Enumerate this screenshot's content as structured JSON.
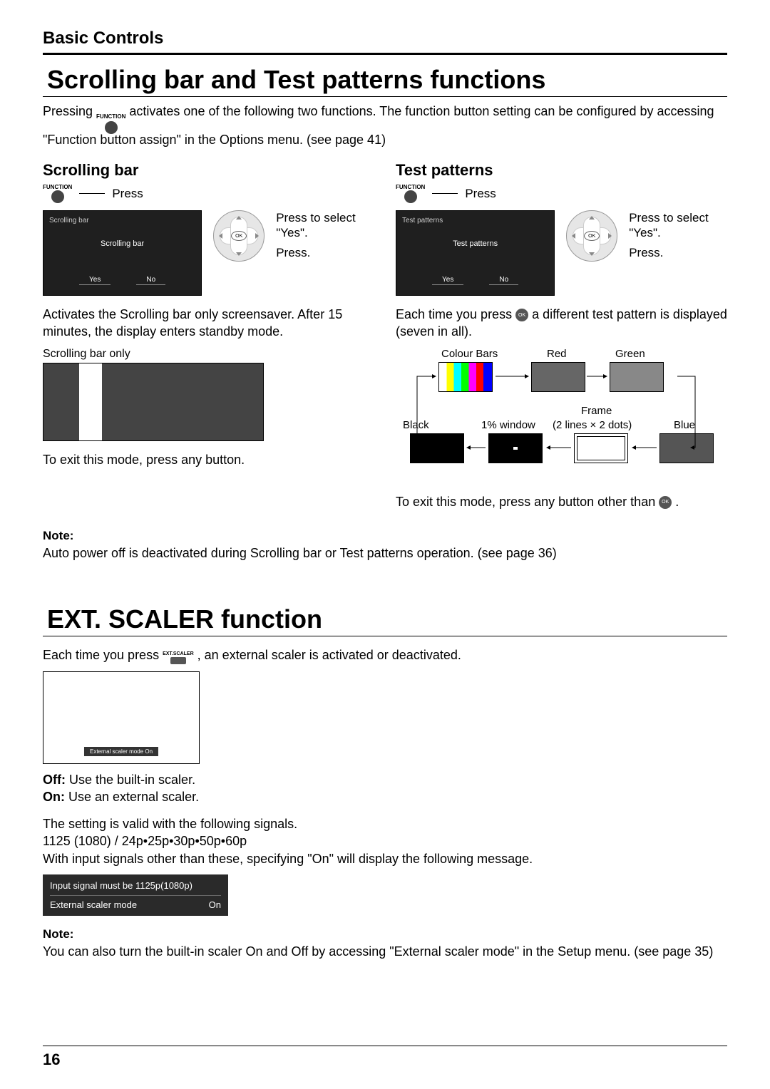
{
  "header": "Basic Controls",
  "title1": "Scrolling bar and Test patterns functions",
  "intro1_a": "Pressing ",
  "intro1_b": " activates one of the following two functions. The function button setting can be configured by accessing \"Function button assign\" in the Options menu. (see page 41)",
  "function_label": "FUNCTION",
  "scrolling": {
    "heading": "Scrolling bar",
    "press": "Press",
    "osd_title": "Scrolling bar",
    "osd_center": "Scrolling bar",
    "yes": "Yes",
    "no": "No",
    "cap1": "Press to select \"Yes\".",
    "cap2": "Press.",
    "desc": "Activates the Scrolling bar only screensaver. After 15 minutes, the display enters standby mode.",
    "only_label": "Scrolling bar only",
    "exit": "To exit this mode, press any button."
  },
  "test": {
    "heading": "Test patterns",
    "press": "Press",
    "osd_title": "Test patterns",
    "osd_center": "Test patterns",
    "yes": "Yes",
    "no": "No",
    "cap1": "Press to select \"Yes\".",
    "cap2": "Press.",
    "desc_a": "Each time you press ",
    "desc_b": " a different test pattern is displayed (seven in all).",
    "labels": {
      "colour_bars": "Colour Bars",
      "red": "Red",
      "green": "Green",
      "frame": "Frame",
      "black": "Black",
      "one_pct": "1% window",
      "lines": "(2 lines × 2 dots)",
      "blue": "Blue"
    },
    "exit_a": "To exit this mode, press any button other than ",
    "exit_b": "."
  },
  "note1_label": "Note:",
  "note1_text": "Auto power off is deactivated during Scrolling bar or Test patterns operation. (see page 36)",
  "title2": "EXT. SCALER function",
  "ext": {
    "intro_a": "Each time you press ",
    "intro_b": ", an external scaler is activated or deactivated.",
    "btn_label": "EXT.SCALER",
    "osd_tag": "External scaler mode       On",
    "off_label": "Off:",
    "off_text": " Use the built-in scaler.",
    "on_label": "On:",
    "on_text": " Use an external scaler.",
    "valid": "The setting is valid with the following signals.",
    "signals": "1125 (1080) / 24p•25p•30p•50p•60p",
    "other": "With input signals other than these, specifying \"On\" will display the following message.",
    "msg_line1": "Input signal must be 1125p(1080p)",
    "msg_line2a": "External scaler mode",
    "msg_line2b": "On"
  },
  "note2_label": "Note:",
  "note2_text": "You can also turn the built-in scaler On and Off by accessing \"External scaler mode\" in the Setup menu. (see page 35)",
  "page_number": "16",
  "ok": "OK"
}
